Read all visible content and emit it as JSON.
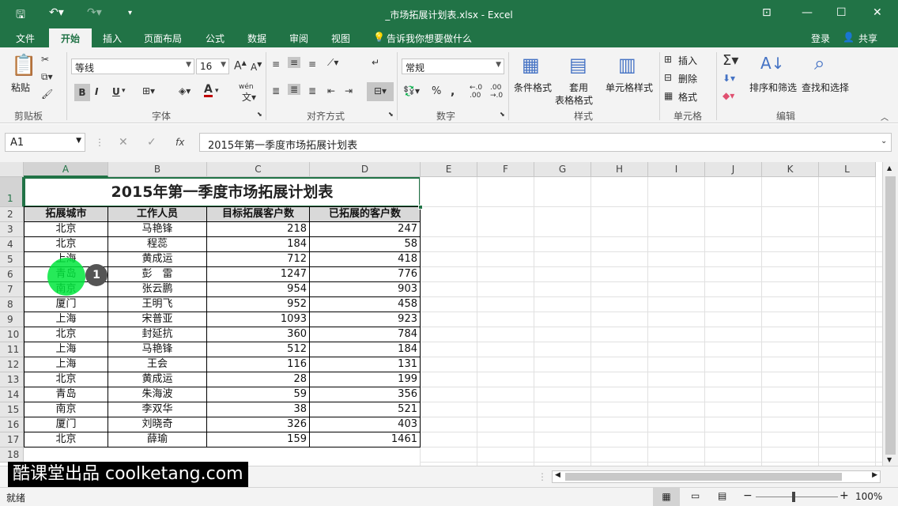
{
  "window": {
    "title": "_市场拓展计划表.xlsx - Excel"
  },
  "tabs": [
    "文件",
    "开始",
    "插入",
    "页面布局",
    "公式",
    "数据",
    "审阅",
    "视图"
  ],
  "tell_me": "告诉我你想要做什么",
  "account": {
    "login": "登录",
    "share": "共享"
  },
  "ribbon": {
    "font_name": "等线",
    "font_size": "16",
    "number_format": "常规",
    "groups": {
      "clipboard": "剪贴板",
      "font": "字体",
      "align": "对齐方式",
      "number": "数字",
      "styles": "样式",
      "cells": "单元格",
      "edit": "编辑"
    },
    "paste": "粘贴",
    "cond_format": "条件格式",
    "table_format_1": "套用",
    "table_format_2": "表格格式",
    "cell_styles": "单元格样式",
    "insert": "插入",
    "delete": "删除",
    "format": "格式",
    "sort_filter": "排序和筛选",
    "find_select": "查找和选择",
    "bold": "B",
    "italic": "I",
    "underline": "U",
    "wen": "wén"
  },
  "formula_bar": {
    "name_box": "A1",
    "fx": "fx",
    "content": "2015年第一季度市场拓展计划表"
  },
  "columns": [
    "A",
    "B",
    "C",
    "D",
    "E",
    "F",
    "G",
    "H",
    "I",
    "J",
    "K",
    "L"
  ],
  "rows": [
    "1",
    "2",
    "3",
    "4",
    "5",
    "6",
    "7",
    "8",
    "9",
    "10",
    "11",
    "12",
    "13",
    "14",
    "15",
    "16",
    "17",
    "18"
  ],
  "sheet": {
    "title": "2015年第一季度市场拓展计划表",
    "headers": [
      "拓展城市",
      "工作人员",
      "目标拓展客户数",
      "已拓展的客户数"
    ],
    "data": [
      [
        "北京",
        "马艳锋",
        "218",
        "247"
      ],
      [
        "北京",
        "程蕊",
        "184",
        "58"
      ],
      [
        "上海",
        "黄成运",
        "712",
        "418"
      ],
      [
        "青岛",
        "彭　雷",
        "1247",
        "776"
      ],
      [
        "南京",
        "张云鹏",
        "954",
        "903"
      ],
      [
        "厦门",
        "王明飞",
        "952",
        "458"
      ],
      [
        "上海",
        "宋普亚",
        "1093",
        "923"
      ],
      [
        "北京",
        "封延抗",
        "360",
        "784"
      ],
      [
        "上海",
        "马艳锋",
        "512",
        "184"
      ],
      [
        "上海",
        "王会",
        "116",
        "131"
      ],
      [
        "北京",
        "黄成运",
        "28",
        "199"
      ],
      [
        "青岛",
        "朱海波",
        "59",
        "356"
      ],
      [
        "南京",
        "李双华",
        "38",
        "521"
      ],
      [
        "厦门",
        "刘晓奇",
        "326",
        "403"
      ],
      [
        "北京",
        "薛瑜",
        "159",
        "1461"
      ]
    ]
  },
  "status": {
    "ready": "就绪",
    "zoom": "100%"
  },
  "watermark": "酷课堂出品 coolketang.com",
  "step_badge": "1",
  "colors": {
    "accent": "#217346"
  }
}
